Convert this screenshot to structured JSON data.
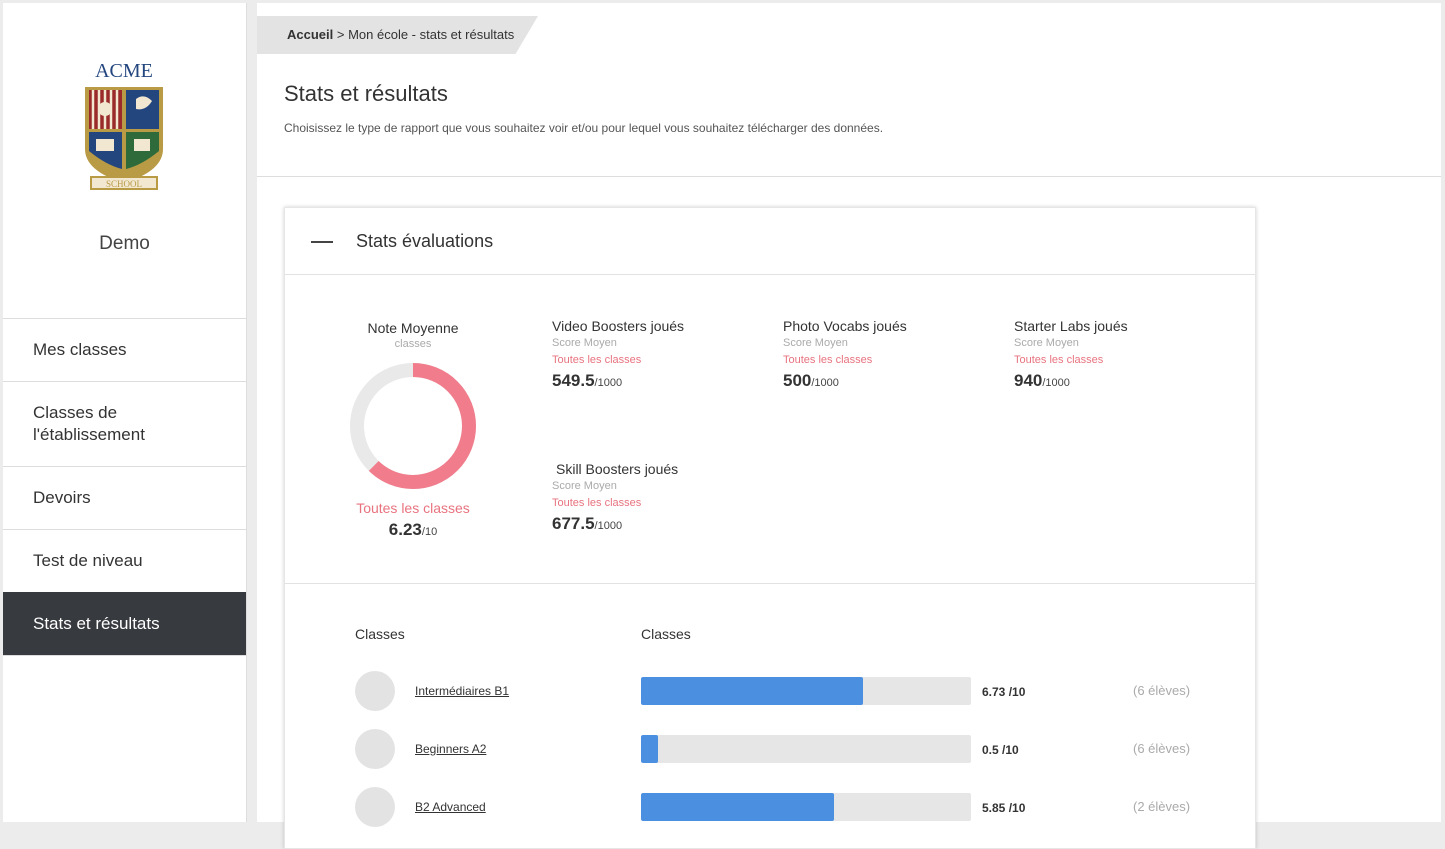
{
  "sidebar": {
    "logo": {
      "top_text": "ACME",
      "banner_text": "SCHOOL",
      "colors": {
        "gold": "#b99a45",
        "red": "#9b2a2a",
        "blue": "#24467f",
        "green": "#2f6b3a"
      }
    },
    "school_name": "Demo",
    "items": [
      {
        "label": "Mes classes",
        "active": false
      },
      {
        "label": "Classes de l'établissement",
        "active": false
      },
      {
        "label": "Devoirs",
        "active": false
      },
      {
        "label": "Test de niveau",
        "active": false
      },
      {
        "label": "Stats et résultats",
        "active": true
      }
    ]
  },
  "breadcrumb": {
    "home": "Accueil",
    "separator": " > ",
    "current": "Mon école - stats et résultats"
  },
  "header": {
    "title": "Stats et résultats",
    "description": "Choisissez le type de rapport que vous souhaitez voir et/ou pour lequel vous souhaitez télécharger des données."
  },
  "stats_card": {
    "title": "Stats évaluations",
    "note_moyenne": {
      "title": "Note Moyenne",
      "subtitle": "classes",
      "all_label": "Toutes les classes",
      "value": "6.23",
      "max": "/10",
      "ratio": 0.623,
      "colors": {
        "fill": "#f07c8c",
        "track": "#e9e9e9"
      }
    },
    "stats": [
      {
        "title": "Video Boosters joués",
        "sub": "Score Moyen",
        "link": "Toutes les classes",
        "value": "549.5",
        "max": "/1000"
      },
      {
        "title": "Photo Vocabs joués",
        "sub": "Score Moyen",
        "link": "Toutes les classes",
        "value": "500",
        "max": "/1000"
      },
      {
        "title": "Starter Labs joués",
        "sub": "Score Moyen",
        "link": "Toutes les classes",
        "value": "940",
        "max": "/1000"
      },
      {
        "title": "Skill Boosters joués",
        "sub": "Score Moyen",
        "link": "Toutes les classes",
        "value": "677.5",
        "max": "/1000"
      }
    ]
  },
  "classes_list": {
    "headers": [
      "Classes",
      "Classes"
    ],
    "rows": [
      {
        "name": "Intermédiaires B1",
        "score": "6.73",
        "max": " /10",
        "ratio": 0.673,
        "pupils": "(6 élèves)"
      },
      {
        "name": "Beginners A2",
        "score": "0.5",
        "max": " /10",
        "ratio": 0.05,
        "pupils": "(6 élèves)"
      },
      {
        "name": "B2 Advanced",
        "score": "5.85",
        "max": " /10",
        "ratio": 0.585,
        "pupils": "(2 élèves)"
      }
    ],
    "bar_color": "#4a8fe0"
  }
}
